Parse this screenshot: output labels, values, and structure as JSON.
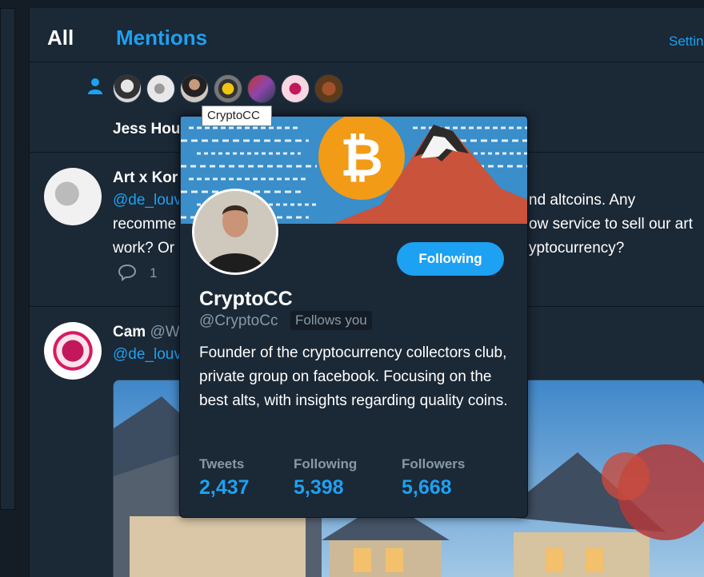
{
  "header": {
    "tab_all": "All",
    "tab_mentions": "Mentions",
    "settings_label": "Settin"
  },
  "activity": {
    "name_fragment": "Jess Hou"
  },
  "tooltip": "CryptoCC",
  "tweets": [
    {
      "name_fragment": "Art x Kor",
      "handle_fragment": "@de_louv",
      "lines": [
        {
          "left": "",
          "right": "nd altcoins. Any"
        },
        {
          "left": "recomme",
          "right": "ow service to sell our art"
        },
        {
          "left": "work? Or",
          "right": "yptocurrency?"
        }
      ],
      "reply_count": "1"
    },
    {
      "name_fragment": "Cam",
      "handle_inline": "@W",
      "handle_fragment": "@de_louv"
    }
  ],
  "profile_card": {
    "name": "CryptoCC",
    "handle": "@CryptoCc",
    "follows_you": "Follows you",
    "follow_button": "Following",
    "bio": "Founder of the cryptocurrency collectors club, private group on facebook. Focusing on the best alts, with insights regarding quality coins.",
    "stats": [
      {
        "label": "Tweets",
        "value": "2,437"
      },
      {
        "label": "Following",
        "value": "5,398"
      },
      {
        "label": "Followers",
        "value": "5,668"
      }
    ]
  },
  "colors": {
    "accent": "#1da1f2",
    "background": "#141d26",
    "panel": "#1b2836",
    "muted": "#8899a6"
  },
  "icons": {
    "person": "person-icon",
    "reply": "reply-icon"
  }
}
